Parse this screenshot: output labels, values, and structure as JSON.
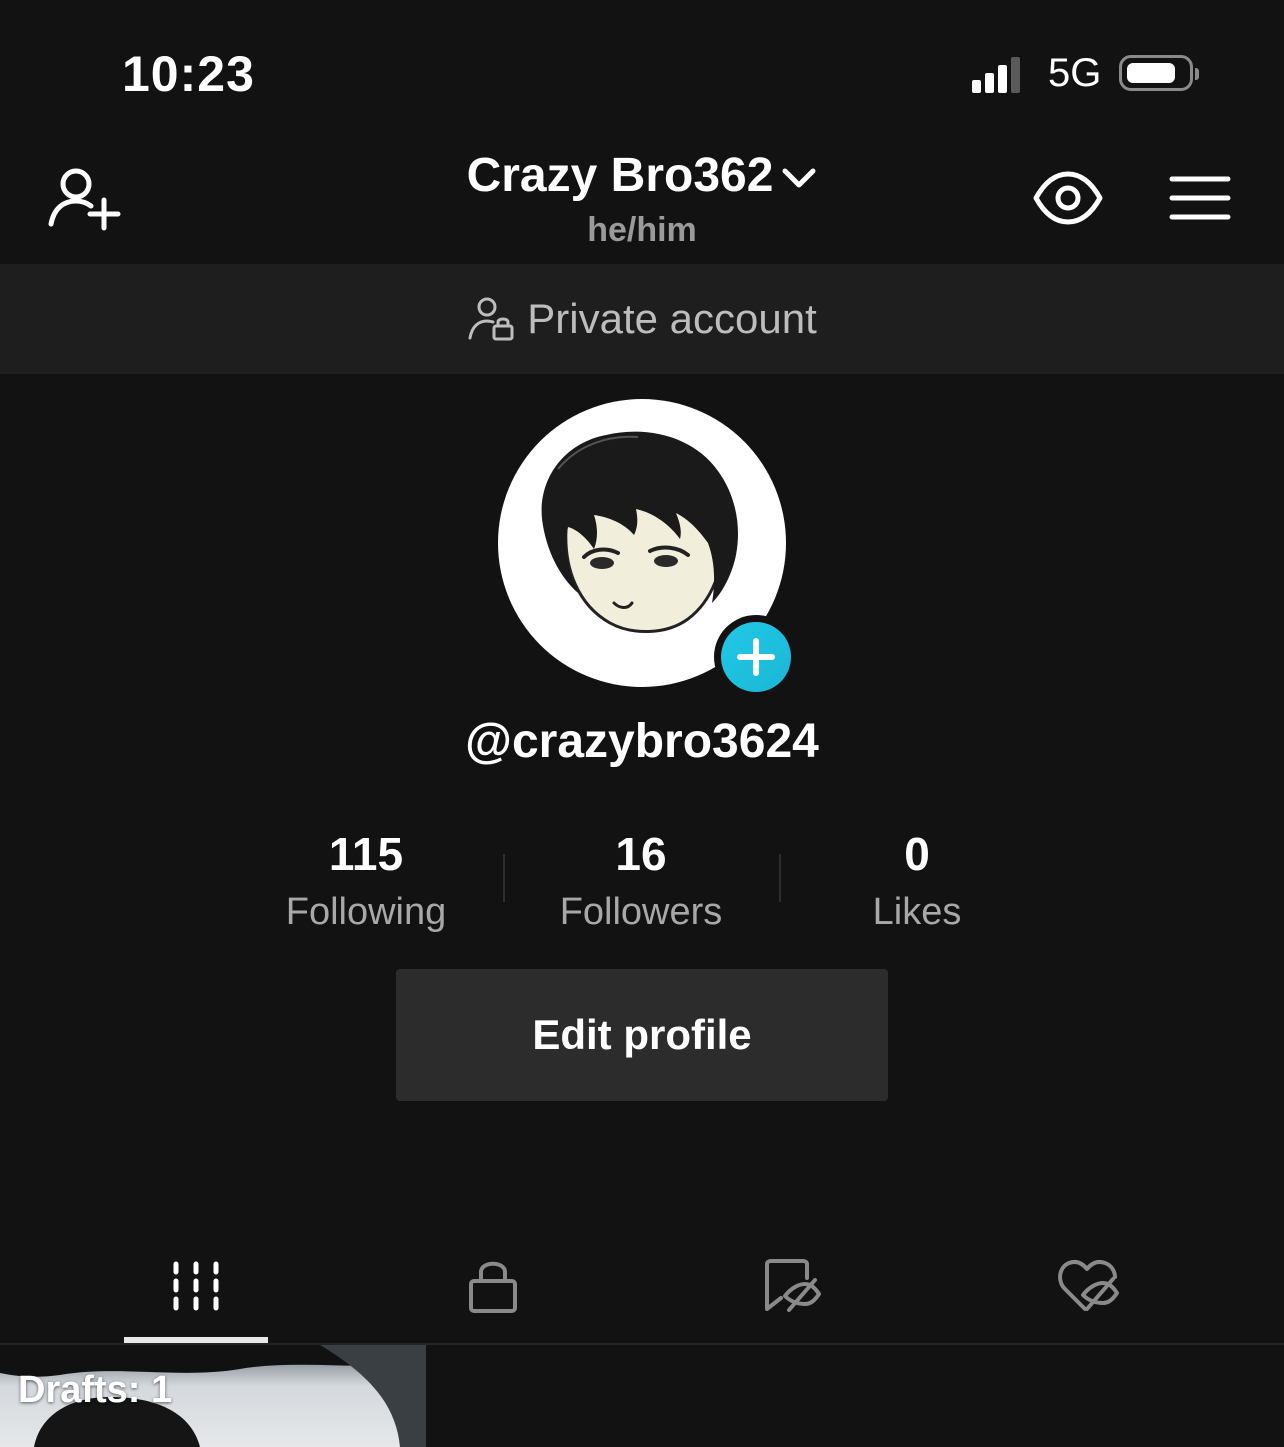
{
  "status_bar": {
    "time": "10:23",
    "network": "5G",
    "icons": [
      "signal-icon",
      "battery-icon"
    ]
  },
  "header": {
    "display_name": "Crazy Bro362",
    "pronouns": "he/him",
    "icons": [
      "add-friend-icon",
      "chevron-down-icon",
      "eye-icon",
      "menu-icon"
    ]
  },
  "banner": {
    "text": "Private account",
    "icon": "person-lock-icon"
  },
  "profile": {
    "username": "@crazybro3624",
    "avatar_icon": "anime-avatar",
    "add_icon": "plus-icon"
  },
  "stats": [
    {
      "value": "115",
      "label": "Following"
    },
    {
      "value": "16",
      "label": "Followers"
    },
    {
      "value": "0",
      "label": "Likes"
    }
  ],
  "edit_profile_label": "Edit profile",
  "tabs": [
    {
      "icon": "grid-icon",
      "active": true
    },
    {
      "icon": "lock-icon",
      "active": false
    },
    {
      "icon": "bookmark-hidden-icon",
      "active": false
    },
    {
      "icon": "heart-hidden-icon",
      "active": false
    }
  ],
  "drafts": {
    "label": "Drafts: 1"
  },
  "colors": {
    "background": "#121212",
    "banner": "#1e1e1e",
    "button": "#2c2c2c",
    "accent": "#21c9e6"
  }
}
